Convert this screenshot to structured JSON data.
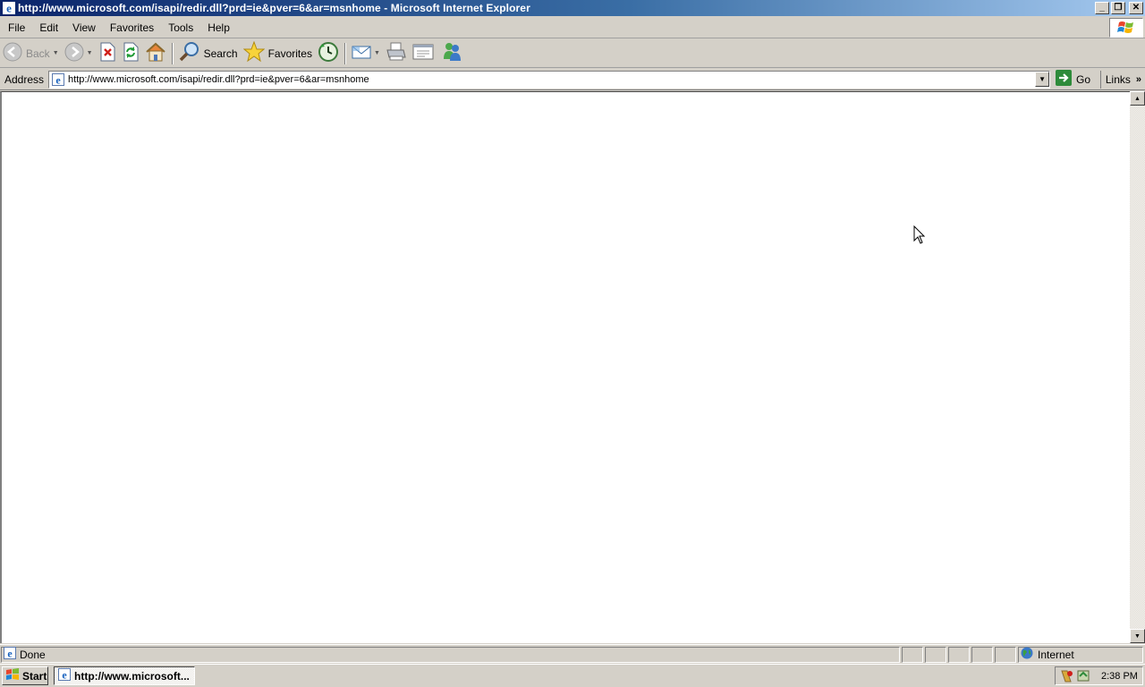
{
  "window": {
    "title": "http://www.microsoft.com/isapi/redir.dll?prd=ie&pver=6&ar=msnhome - Microsoft Internet Explorer",
    "minimize_glyph": "_",
    "restore_glyph": "❐",
    "close_glyph": "✕"
  },
  "menu": {
    "items": [
      "File",
      "Edit",
      "View",
      "Favorites",
      "Tools",
      "Help"
    ]
  },
  "toolbar": {
    "back_label": "Back",
    "search_label": "Search",
    "favorites_label": "Favorites",
    "icons": [
      "back-arrow-icon",
      "forward-arrow-icon",
      "stop-icon",
      "refresh-icon",
      "home-icon",
      "search-icon",
      "favorites-star-icon",
      "history-icon",
      "mail-icon",
      "print-icon",
      "edit-icon",
      "messenger-icon"
    ]
  },
  "address_bar": {
    "label": "Address",
    "url": "http://www.microsoft.com/isapi/redir.dll?prd=ie&pver=6&ar=msnhome",
    "go_label": "Go",
    "links_label": "Links",
    "links_chevron": "»"
  },
  "status_bar": {
    "status_text": "Done",
    "zone_text": "Internet"
  },
  "taskbar": {
    "start_label": "Start",
    "task_label": "http://www.microsoft...",
    "clock": "2:38 PM"
  },
  "colors": {
    "title_gradient_start": "#0a246a",
    "title_gradient_end": "#a6caf0",
    "chrome": "#d4d0c8",
    "content_bg": "#ffffff",
    "go_green": "#2e8b3a"
  }
}
